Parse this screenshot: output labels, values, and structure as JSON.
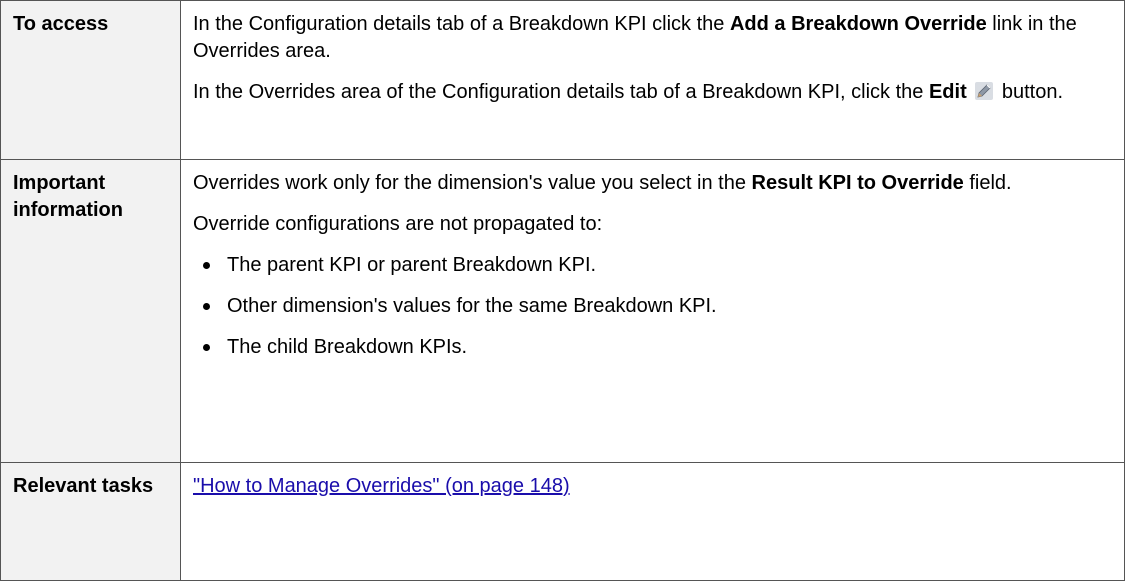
{
  "rows": [
    {
      "label": "To access",
      "p1": {
        "pre": "In the Configuration details tab of a Breakdown KPI click the ",
        "bold": "Add a Breakdown Override",
        "post": " link in the Overrides area."
      },
      "p2": {
        "pre": "In the Overrides area of the Configuration details tab of a Breakdown KPI, click the ",
        "bold": "Edit",
        "icon": "pencil-edit-icon",
        "post": " button."
      }
    },
    {
      "label": "Important information",
      "p1": {
        "pre": "Overrides work only for the dimension's value you select in the ",
        "bold": "Result KPI to Override",
        "post": " field."
      },
      "p2": "Override configurations are not propagated to:",
      "bullets": [
        "The parent KPI or parent Breakdown KPI.",
        "Other dimension's values for the same Breakdown KPI.",
        "The child Breakdown KPIs."
      ]
    },
    {
      "label": "Relevant tasks",
      "link": "\"How to Manage Overrides\" (on page 148)"
    }
  ]
}
